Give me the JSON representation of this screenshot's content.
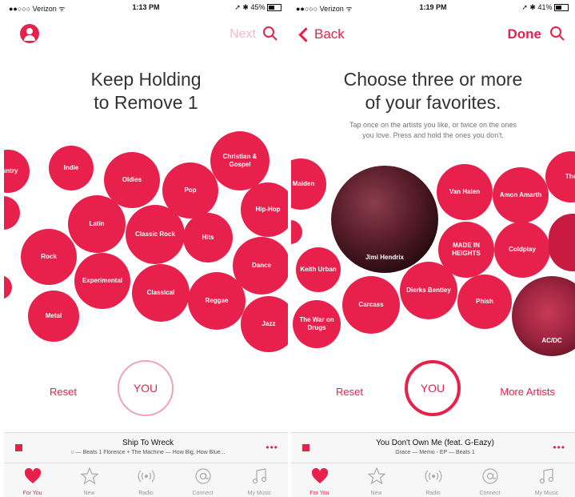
{
  "colors": {
    "accent": "#e8214c",
    "bubble": "#e8214c",
    "next_disabled": "#f3b9c6",
    "tab_inactive": "#999999"
  },
  "left": {
    "status": {
      "carrier": "●●○○○ Verizon ᯤ",
      "time": "1:13 PM",
      "battery": "➚ ✱ 45%"
    },
    "nav": {
      "next": "Next"
    },
    "title_line1": "Keep Holding",
    "title_line2": "to Remove 1",
    "bubbles": [
      "ountry",
      "Indie",
      "Oldies",
      "Pop",
      "Christian & Gospel",
      "Hip-Hop",
      "Latin",
      "Classic Rock",
      "Hits",
      "Rock",
      "Experimental",
      "Classical",
      "Reggae",
      "Dance",
      "Metal",
      "Jazz"
    ],
    "reset": "Reset",
    "you": "YOU",
    "player": {
      "title": "Ship To Wreck",
      "subtitle": "○ — Beats 1   Florence + The Machine — How Big, How Blue..."
    },
    "tabs": [
      "For You",
      "New",
      "Radio",
      "Connect",
      "My Music"
    ]
  },
  "right": {
    "status": {
      "carrier": "●●○○○ Verizon ᯤ",
      "time": "1:19 PM",
      "battery": "➚ ✱ 41%"
    },
    "nav": {
      "back": "Back",
      "done": "Done"
    },
    "title_line1": "Choose three or more",
    "title_line2": "of your favorites.",
    "subtitle_line1": "Tap once on the artists you like, or twice on the ones",
    "subtitle_line2": "you love. Press and hold the ones you don't.",
    "bubbles": [
      "n Maiden",
      "Jimi Hendrix",
      "Van Halen",
      "Amon Amarth",
      "The",
      "Keith Urban",
      "MADE IN HEIGHTS",
      "Coldplay",
      "Carcass",
      "Dierks Bentley",
      "Phish",
      "The War on Drugs",
      "AC/DC"
    ],
    "reset": "Reset",
    "you": "YOU",
    "more": "More Artists",
    "player": {
      "title": "You Don't Own Me (feat. G-Eazy)",
      "subtitle": "Grace — Memo - EP — Beats 1"
    },
    "tabs": [
      "For You",
      "New",
      "Radio",
      "Connect",
      "My Music"
    ]
  }
}
